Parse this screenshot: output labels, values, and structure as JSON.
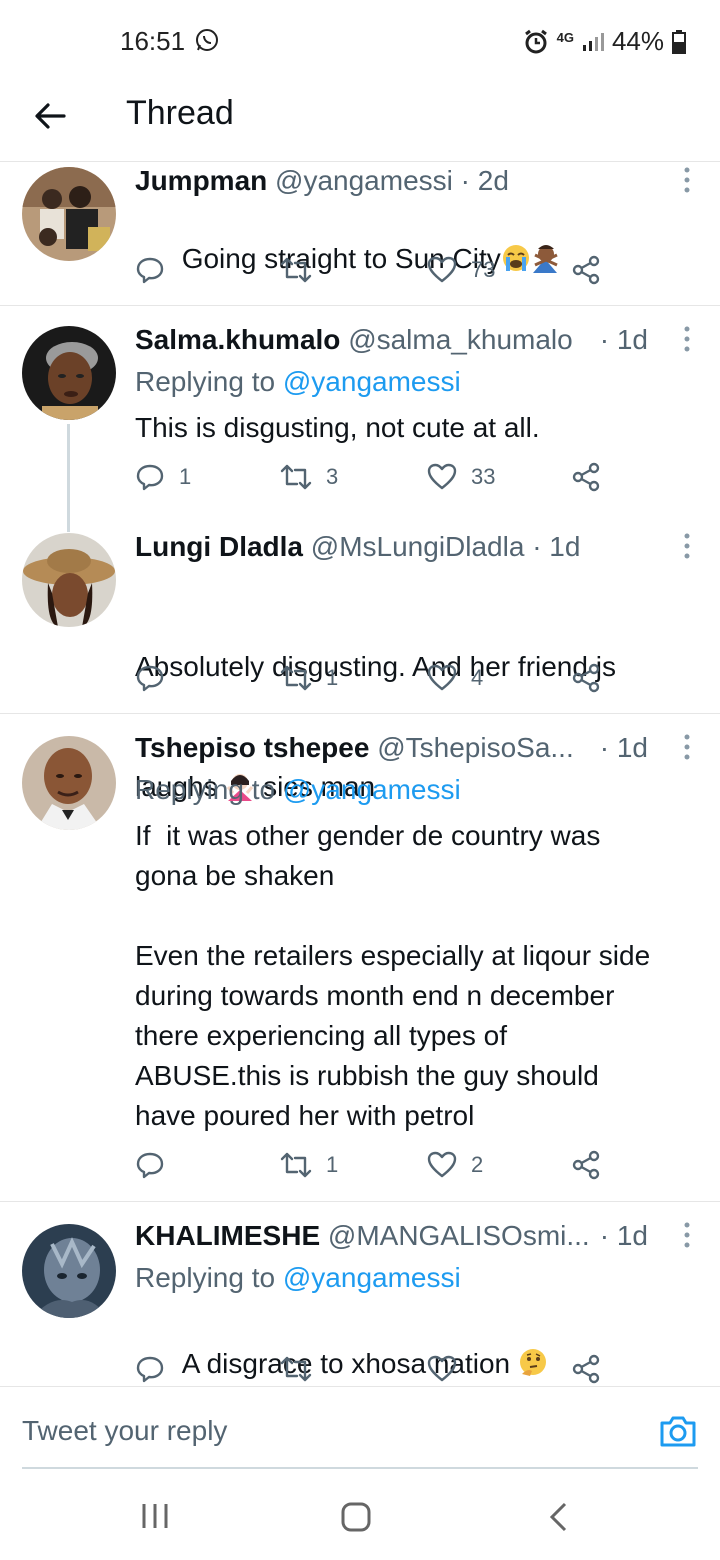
{
  "status_bar": {
    "time": "16:51",
    "network": "4G",
    "battery": "44%"
  },
  "header": {
    "title": "Thread"
  },
  "tweets": [
    {
      "name": "Jumpman",
      "handle": "@yangamessi",
      "date": "· 2d",
      "text": "Going straight to Sun City",
      "reply_count": "",
      "retweet_count": "",
      "like_count": "73"
    },
    {
      "name": "Salma.khumalo",
      "handle": "@salma_khumalo",
      "date": "· 1d",
      "replying_prefix": "Replying to",
      "replying_to": "@yangamessi",
      "text": "This is disgusting, not cute at all.",
      "reply_count": "1",
      "retweet_count": "3",
      "like_count": "33"
    },
    {
      "name": "Lungi Dladla",
      "handle": "@MsLungiDladla",
      "date": "· 1d",
      "text_line1": "Absolutely disgusting. And her friend js",
      "text_line2a": "laughs",
      "text_line2b": "sies man",
      "reply_count": "",
      "retweet_count": "1",
      "like_count": "4"
    },
    {
      "name": "Tshepiso tshepee",
      "handle": "@TshepisoSa...",
      "date": "· 1d",
      "replying_prefix": "Replying to",
      "replying_to": "@yangamessi",
      "text": "If  it was other gender de country was\ngona be shaken\n\nEven the retailers especially at liqour side\nduring towards month end n december\nthere experiencing all types of\nABUSE.this is rubbish the guy should\nhave poured her with petrol",
      "reply_count": "",
      "retweet_count": "1",
      "like_count": "2"
    },
    {
      "name": "KHALIMESHE",
      "handle": "@MANGALISOsmi...",
      "date": "· 1d",
      "replying_prefix": "Replying to",
      "replying_to": "@yangamessi",
      "text": "A disgrace to xhosa nation",
      "reply_count": "",
      "retweet_count": "",
      "like_count": ""
    }
  ],
  "composer": {
    "placeholder": "Tweet your reply"
  },
  "icons": {
    "back": "arrow-left-icon",
    "more": "more-vertical-icon",
    "reply": "comment-icon",
    "retweet": "retweet-icon",
    "like": "heart-icon",
    "share": "share-icon",
    "camera": "camera-icon"
  },
  "colors": {
    "accent": "#1d9bf0",
    "secondary_text": "#536471"
  }
}
